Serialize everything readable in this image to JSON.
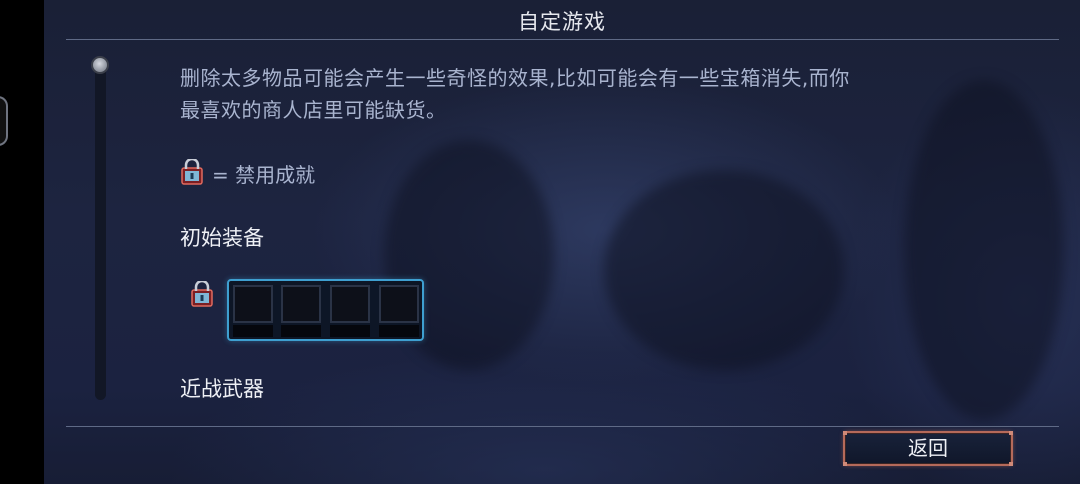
{
  "title": "自定游戏",
  "warning": {
    "line1": "删除太多物品可能会产生一些奇怪的效果,比如可能会有一些宝箱消失,而你",
    "line2": "最喜欢的商人店里可能缺货。"
  },
  "legend": {
    "icon": "lock-icon",
    "text": "= 禁用成就"
  },
  "sections": {
    "starting_equipment": "初始装备",
    "melee_weapons": "近战武器"
  },
  "slots": {
    "count": 4
  },
  "buttons": {
    "back": "返回"
  },
  "colors": {
    "accent_slot_border": "#3e9fd0",
    "back_button_border": "#b56a5a",
    "lock_body": "#7a1f24"
  }
}
